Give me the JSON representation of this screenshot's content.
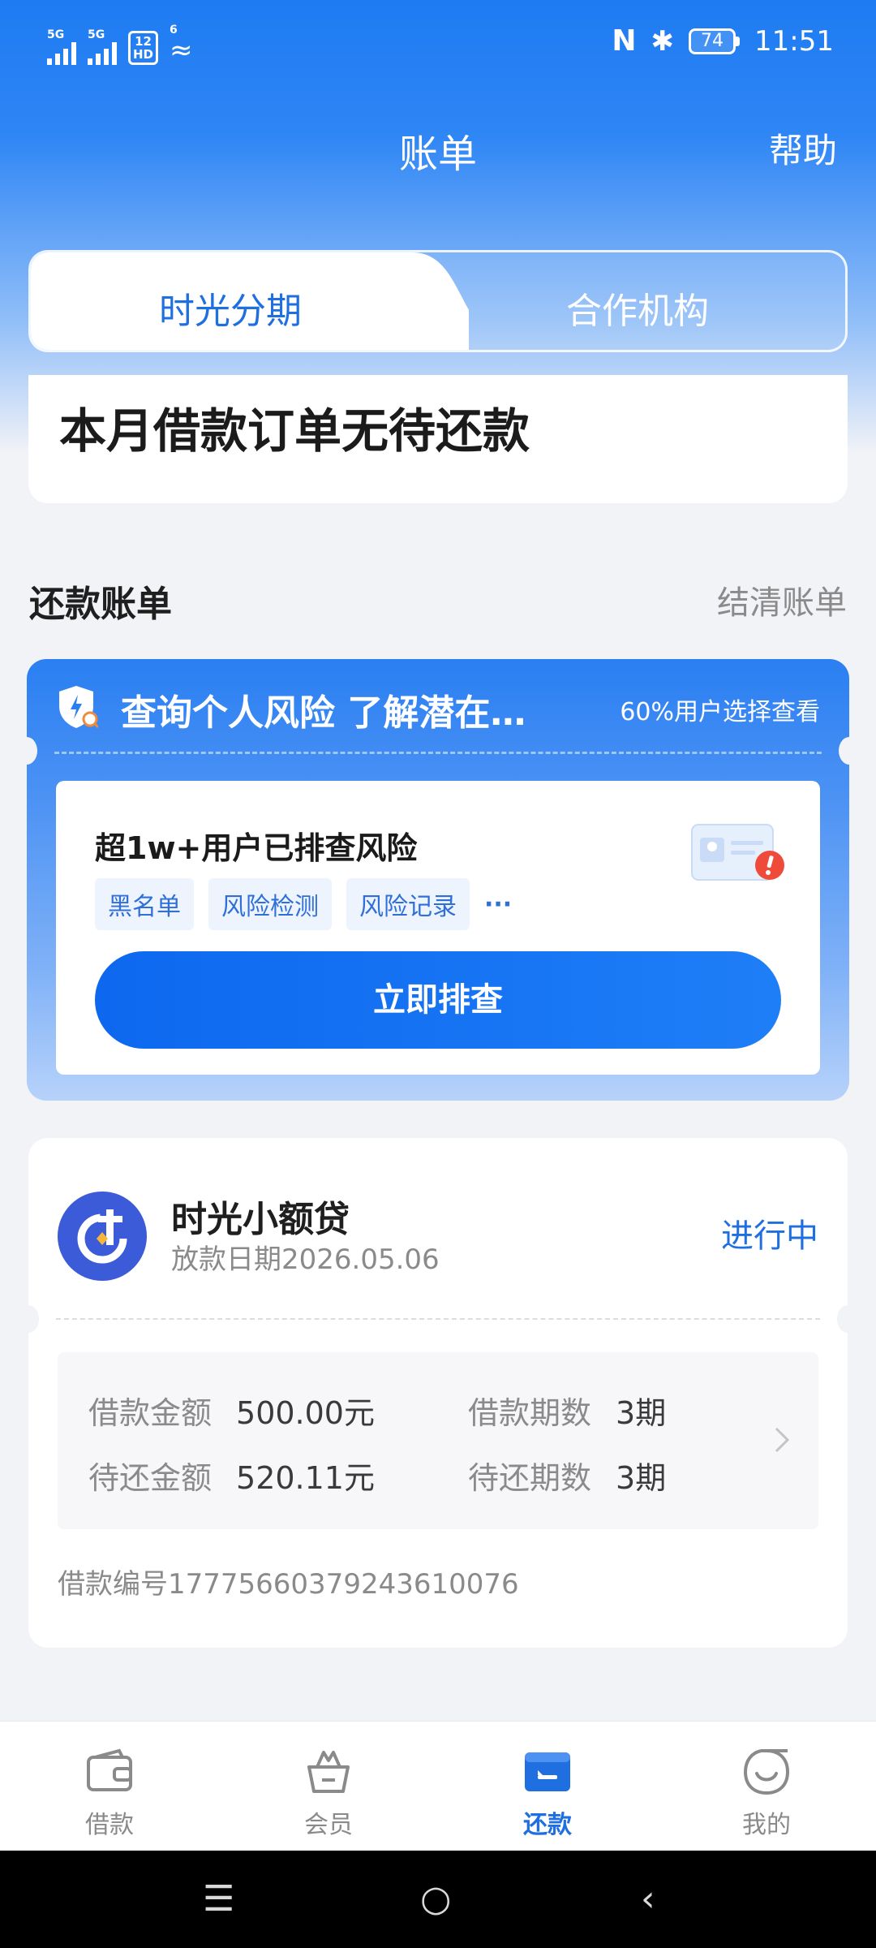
{
  "status_bar": {
    "sim1": "5G",
    "sim2": "5G",
    "hd_top": "12",
    "hd_bottom": "HD",
    "wifi": "6",
    "nfc": "N",
    "battery": "74",
    "time": "11:51"
  },
  "header": {
    "title": "账单",
    "help": "帮助"
  },
  "tabs": [
    {
      "label": "时光分期",
      "active": true
    },
    {
      "label": "合作机构",
      "active": false
    }
  ],
  "summary": {
    "text": "本月借款订单无待还款"
  },
  "section": {
    "title": "还款账单",
    "link": "结清账单"
  },
  "risk_card": {
    "title": "查询个人风险 了解潜在…",
    "stat": "60%用户选择查看",
    "headline": "超1w+用户已排查风险",
    "tags": [
      "黑名单",
      "风险检测",
      "风险记录"
    ],
    "more": "···",
    "button": "立即排查"
  },
  "loan": {
    "name": "时光小额贷",
    "date": "放款日期2026.05.06",
    "status": "进行中",
    "amount_label": "借款金额",
    "amount_value": "500.00元",
    "periods_label": "借款期数",
    "periods_value": "3期",
    "due_label": "待还金额",
    "due_value": "520.11元",
    "due_periods_label": "待还期数",
    "due_periods_value": "3期",
    "loan_no": "借款编号17775660379243610076"
  },
  "bottom_nav": [
    {
      "label": "借款",
      "icon": "wallet-icon",
      "active": false
    },
    {
      "label": "会员",
      "icon": "basket-icon",
      "active": false
    },
    {
      "label": "还款",
      "icon": "card-icon",
      "active": true
    },
    {
      "label": "我的",
      "icon": "smile-icon",
      "active": false
    }
  ],
  "colors": {
    "primary": "#1f6fe0",
    "header_blue": "#1e7bf2",
    "background": "#f2f3f7"
  }
}
